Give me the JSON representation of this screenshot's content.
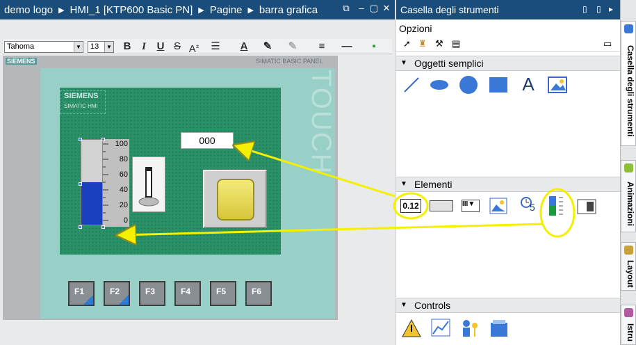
{
  "editor_title": {
    "breadcrumbs": [
      "demo logo",
      "HMI_1 [KTP600 Basic PN]",
      "Pagine",
      "barra grafica"
    ],
    "window_buttons": [
      "restore-icon",
      "minimize-icon",
      "maximize-icon",
      "close-icon"
    ]
  },
  "toolbar": {
    "font_name": "Tahoma",
    "font_size": "13",
    "buttons": [
      "B",
      "I",
      "U",
      "S",
      "A"
    ]
  },
  "panel": {
    "brand": "SIEMENS",
    "panel_type": "SIMATIC BASIC PANEL",
    "logo_brand": "SIEMENS",
    "logo_sub": "SIMATIC HMI",
    "touch_label": "TOUCH"
  },
  "screen": {
    "io_field_value": "000",
    "bar_graph": {
      "ticks": [
        "100",
        "80",
        "60",
        "40",
        "20",
        "0"
      ],
      "level_percent": 50,
      "fill_color": "#1a3fbf"
    }
  },
  "fkeys": [
    "F1",
    "F2",
    "F3",
    "F4",
    "F5",
    "F6"
  ],
  "toolbox": {
    "title": "Casella degli strumenti",
    "options_label": "Opzioni",
    "sections": [
      {
        "label": "Oggetti semplici"
      },
      {
        "label": "Elementi"
      },
      {
        "label": "Controls"
      }
    ],
    "elementi_io_label": "0.12",
    "simple_text_tool": "A",
    "clock_digit": "5",
    "side_tabs": [
      "Casella degli strumenti",
      "Animazioni",
      "Layout",
      "Istru"
    ]
  },
  "colors": {
    "title_bar": "#1b4d7a",
    "screen_green": "#2a9067",
    "bezel": "#98cfc6",
    "highlight": "#f5f000"
  }
}
